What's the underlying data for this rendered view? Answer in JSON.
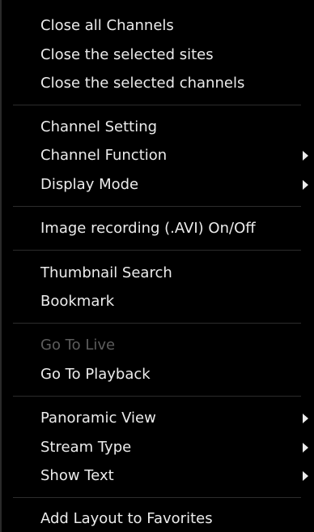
{
  "menu": {
    "items": [
      {
        "label": "Close all Channels"
      },
      {
        "label": "Close the selected sites"
      },
      {
        "label": "Close the selected channels"
      },
      {
        "label": "Channel Setting"
      },
      {
        "label": "Channel Function"
      },
      {
        "label": "Display Mode"
      },
      {
        "label": "Image recording (.AVI) On/Off"
      },
      {
        "label": "Thumbnail Search"
      },
      {
        "label": "Bookmark"
      },
      {
        "label": "Go To Live"
      },
      {
        "label": "Go To Playback"
      },
      {
        "label": "Panoramic View"
      },
      {
        "label": "Stream Type"
      },
      {
        "label": "Show Text"
      },
      {
        "label": "Add Layout to Favorites"
      }
    ],
    "submenu_arrow_icon": "triangle-right",
    "colors": {
      "background": "#000000",
      "text": "#ececec",
      "disabled_text": "#5d5d5d",
      "separator": "#2c2c2c"
    }
  }
}
